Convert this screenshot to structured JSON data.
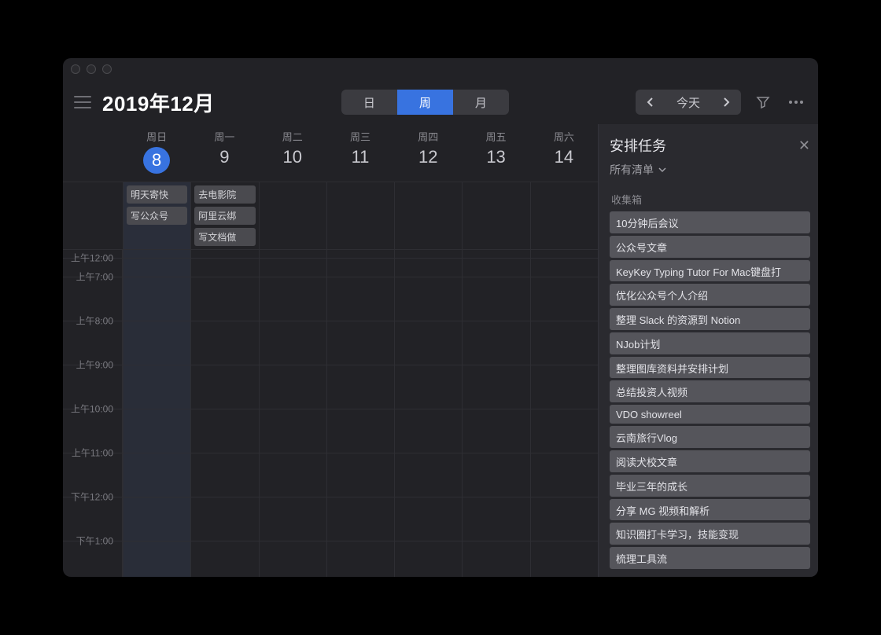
{
  "header": {
    "title": "2019年12月",
    "view_segments": {
      "day": "日",
      "week": "周",
      "month": "月",
      "active": "week"
    },
    "today_label": "今天"
  },
  "days": [
    {
      "dow": "周日",
      "num": "8",
      "today": true
    },
    {
      "dow": "周一",
      "num": "9"
    },
    {
      "dow": "周二",
      "num": "10"
    },
    {
      "dow": "周三",
      "num": "11"
    },
    {
      "dow": "周四",
      "num": "12"
    },
    {
      "dow": "周五",
      "num": "13"
    },
    {
      "dow": "周六",
      "num": "14"
    }
  ],
  "allday_events": {
    "0": [
      "明天寄快",
      "写公众号"
    ],
    "1": [
      "去电影院",
      "阿里云绑",
      "写文档做"
    ]
  },
  "hours": [
    "上午12:00",
    "上午7:00",
    "上午8:00",
    "上午9:00",
    "上午10:00",
    "上午11:00",
    "下午12:00",
    "下午1:00"
  ],
  "side": {
    "title": "安排任务",
    "filter": "所有清单",
    "group": "收集箱",
    "tasks": [
      "10分钟后会议",
      "公众号文章",
      "KeyKey Typing Tutor For Mac键盘打",
      "优化公众号个人介绍",
      "整理 Slack 的资源到 Notion",
      "NJob计划",
      "整理图库资料并安排计划",
      "总结投资人视频",
      "VDO showreel",
      "云南旅行Vlog",
      "阅读犬校文章",
      "毕业三年的成长",
      "分享 MG 视频和解析",
      "知识圈打卡学习，技能变现",
      "梳理工具流"
    ]
  }
}
